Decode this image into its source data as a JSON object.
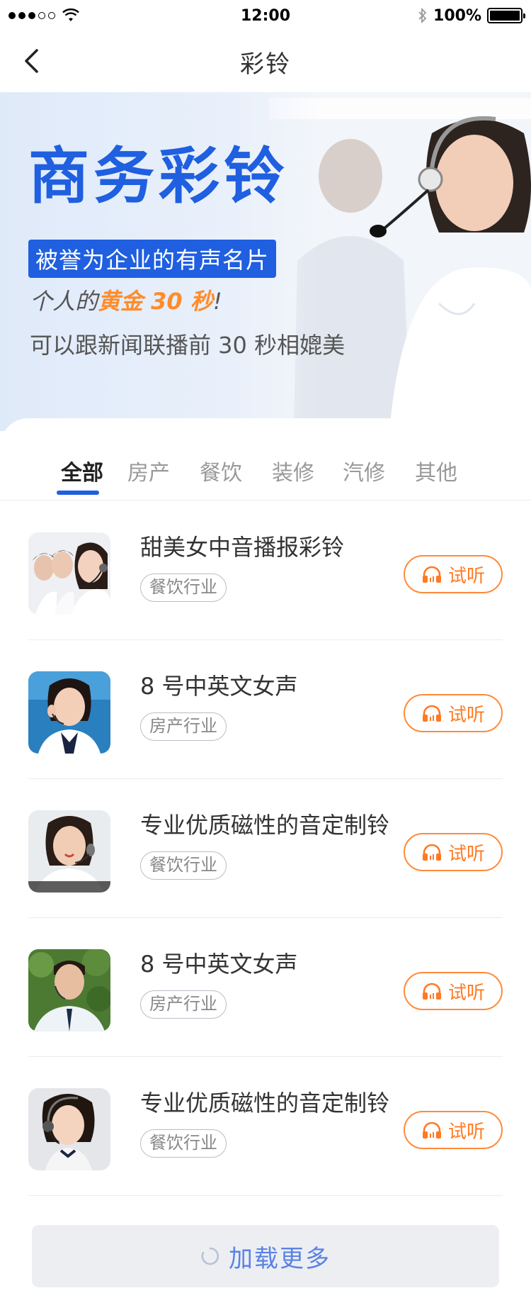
{
  "status_bar": {
    "time": "12:00",
    "battery": "100%"
  },
  "nav": {
    "title": "彩铃"
  },
  "hero": {
    "title": "商务彩铃",
    "badge": "被誉为企业的有声名片",
    "line2_prefix": "个人的",
    "line2_highlight": "黄金 30 秒",
    "line2_suffix": "!",
    "line3": "可以跟新闻联播前 30 秒相媲美"
  },
  "tabs": [
    "全部",
    "房产",
    "餐饮",
    "装修",
    "汽修",
    "其他"
  ],
  "list": [
    {
      "title": "甜美女中音播报彩铃",
      "tag": "餐饮行业",
      "button": "试听"
    },
    {
      "title": "8 号中英文女声",
      "tag": "房产行业",
      "button": "试听"
    },
    {
      "title": "专业优质磁性的音定制铃",
      "tag": "餐饮行业",
      "button": "试听"
    },
    {
      "title": "8 号中英文女声",
      "tag": "房产行业",
      "button": "试听"
    },
    {
      "title": "专业优质磁性的音定制铃",
      "tag": "餐饮行业",
      "button": "试听"
    }
  ],
  "load_more": "加载更多",
  "colors": {
    "brand_blue": "#1f5fe0",
    "accent_orange": "#ff7a22"
  }
}
